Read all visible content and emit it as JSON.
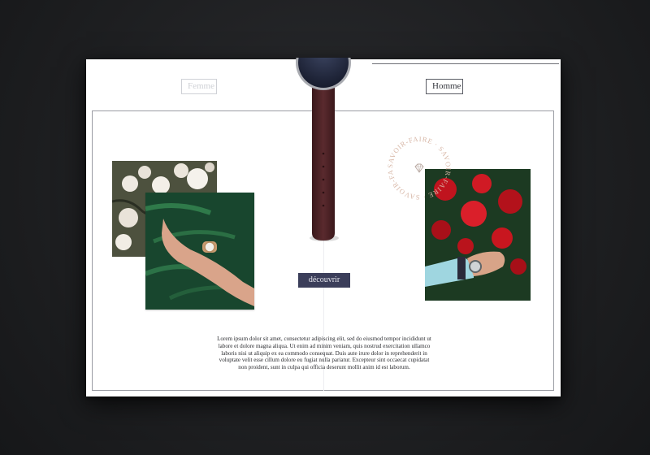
{
  "tabs": {
    "femme": "Femme",
    "homme": "Homme"
  },
  "cta_label": "découvrir",
  "body_text": "Lorem ipsum dolor sit amet, consectetur adipiscing elit, sed do eiusmod tempor incididunt ut labore et dolore magna aliqua. Ut enim ad minim veniam, quis nostrud exercitation ullamco laboris nisi ut aliquip ex ea commodo consequat. Duis aute irure dolor in reprehenderit in voluptate velit esse cillum dolore eu fugiat nulla pariatur. Excepteur sint occaecat cupidatat non proident, sunt in culpa qui officia deserunt mollit anim id est laborum.",
  "badge_text": "SAVOIR-FAIRE · SAVOIR-FAIRE · SAVOIR-FAIRE ·",
  "colors": {
    "page_background": "#1f2022",
    "card": "#ffffff",
    "accent": "#3b3e5a",
    "badge": "#d8b8a8",
    "strap": "#4a2226"
  },
  "icons": [
    "diamond-icon"
  ]
}
